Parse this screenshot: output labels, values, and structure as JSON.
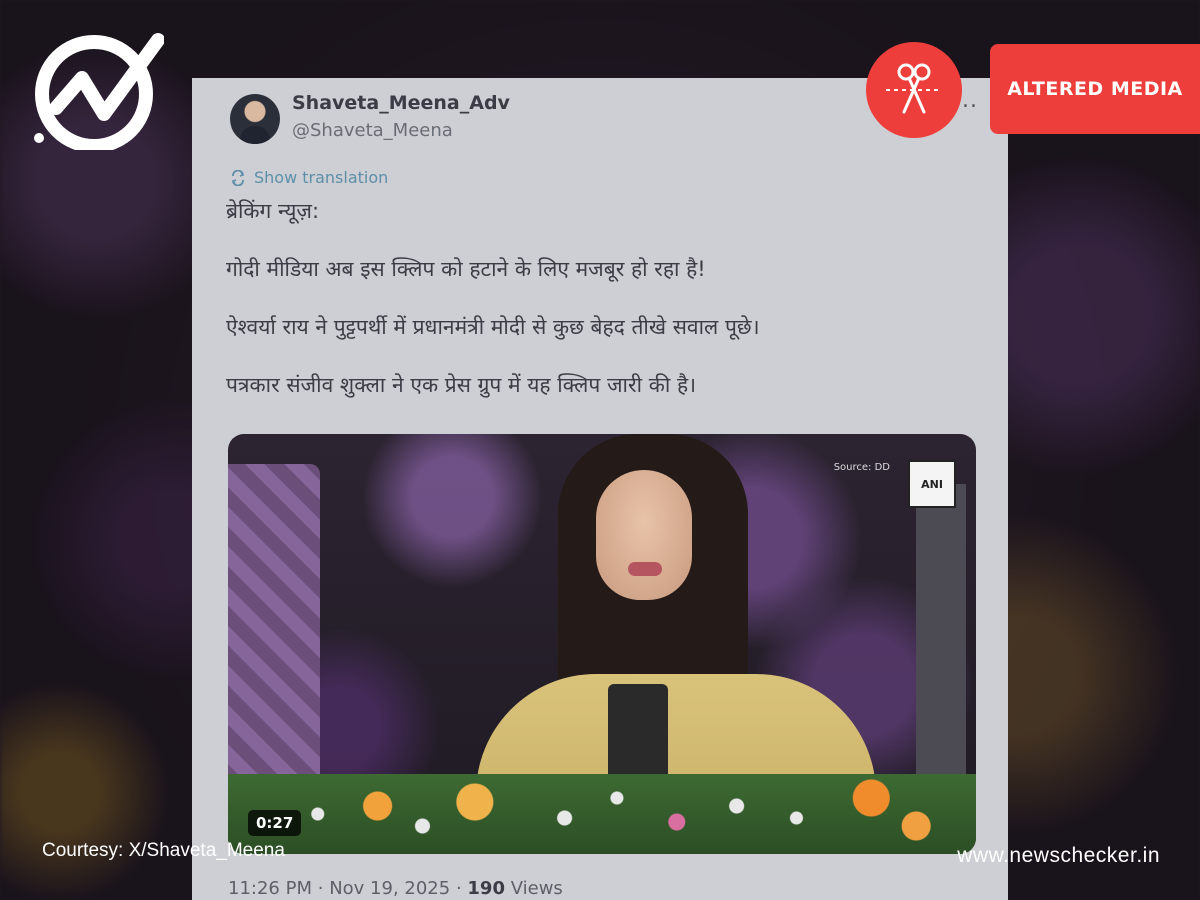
{
  "tweet": {
    "display_name": "Shaveta_Meena_Adv",
    "handle": "@Shaveta_Meena",
    "more": "...",
    "show_translation": "Show translation",
    "paragraphs": [
      "ब्रेकिंग न्यूज़:",
      "गोदी मीडिया अब इस क्लिप को हटाने के लिए मजबूर हो रहा है!",
      "ऐश्वर्या राय ने पुट्टपर्थी में प्रधानमंत्री मोदी से कुछ बेहद तीखे सवाल पूछे।",
      "पत्रकार संजीव शुक्ला ने एक प्रेस ग्रुप में यह क्लिप जारी की है।"
    ],
    "video": {
      "source": "Source: DD",
      "badge": "ANI",
      "duration": "0:27"
    },
    "time": "11:26 PM",
    "date": "Nov 19, 2025",
    "separator": "·",
    "views_count": "190",
    "views_label": "Views"
  },
  "overlay": {
    "label": "ALTERED MEDIA",
    "icon": "scissors-icon",
    "accent": "#ee3e3b",
    "courtesy": "Courtesy: X/Shaveta_Meena",
    "website": "www.newschecker.in"
  },
  "brand": {
    "logo": "checkmark-logo-icon"
  }
}
